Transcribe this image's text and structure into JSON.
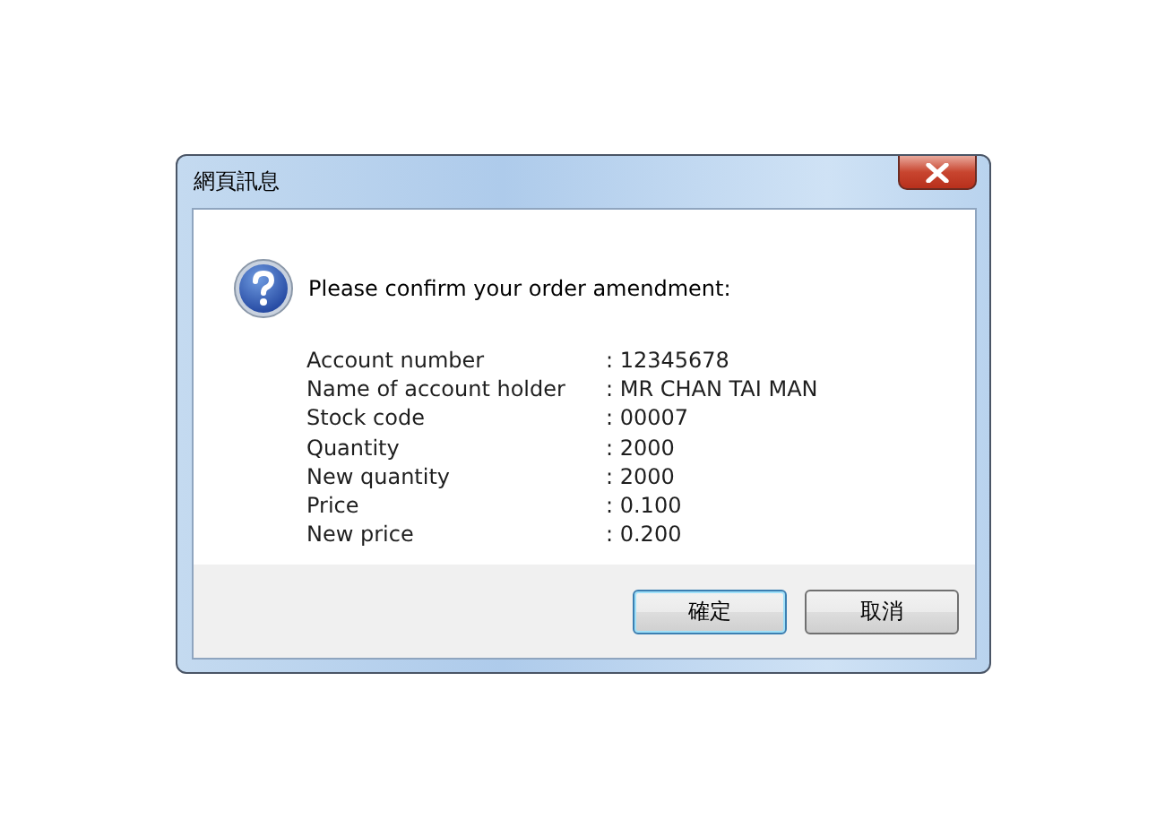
{
  "window": {
    "title": "網頁訊息"
  },
  "message": "Please confirm your order amendment:",
  "details": [
    {
      "label": "Account number",
      "value": ": 12345678"
    },
    {
      "label": "Name of account holder",
      "value": ": MR CHAN TAI MAN"
    },
    {
      "label": "Stock code",
      "value": ": 00007"
    },
    {
      "label": "Quantity",
      "value": ": 2000"
    },
    {
      "label": "New quantity",
      "value": ": 2000"
    },
    {
      "label": "Price",
      "value": ": 0.100"
    },
    {
      "label": "New price",
      "value": ": 0.200"
    }
  ],
  "buttons": [
    {
      "label": "確定",
      "default": true
    },
    {
      "label": "取消",
      "default": false
    }
  ]
}
